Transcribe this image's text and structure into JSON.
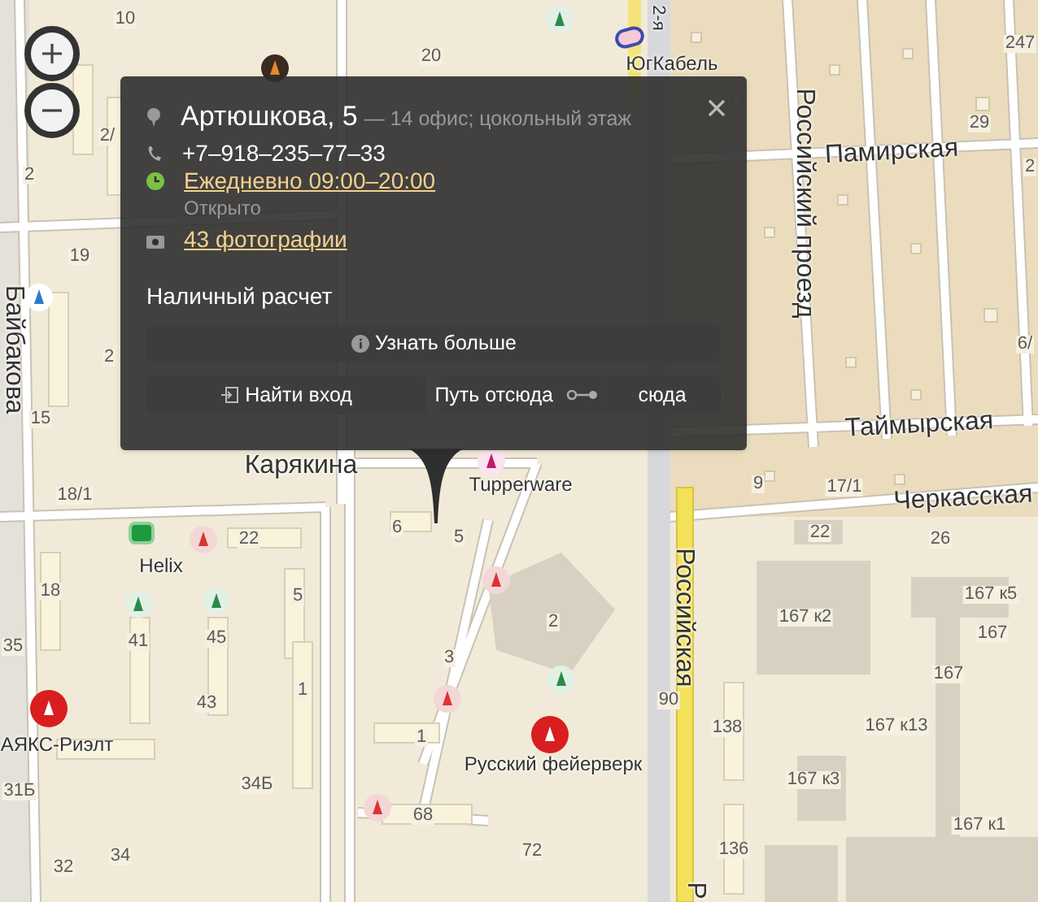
{
  "zoom_controls": [
    {
      "kind": "zoom_in"
    },
    {
      "kind": "zoom_out"
    }
  ],
  "street_labels": [
    "Байбакова",
    "Карякина",
    "Памирская",
    "Российский проезд",
    "Таймырская",
    "Черкасская",
    "Российская",
    "2-я",
    "Р"
  ],
  "place_labels": [
    "ЮгКабель",
    "Tupperware",
    "Helix",
    "АЯКС-Риэлт",
    "Русский фейерверк"
  ],
  "house_numbers": [
    "10",
    "20",
    "2/",
    "2",
    "19",
    "15",
    "18/1",
    "22",
    "18",
    "5",
    "41",
    "45",
    "1",
    "43",
    "35",
    "31Б",
    "34Б",
    "68",
    "32",
    "34",
    "6",
    "5",
    "3",
    "1",
    "2",
    "90",
    "138",
    "136",
    "167 к2",
    "167 к5",
    "167",
    "167",
    "167 к13",
    "167 к3",
    "167 к1",
    "22",
    "26",
    "72",
    "9",
    "17/1",
    "29",
    "247",
    "2",
    "6/",
    "2"
  ],
  "popup": {
    "title": "Артюшкова, 5",
    "subtitle": "— 14 офис; цокольный этаж",
    "phone": "+7–918–235–77–33",
    "hours": "Ежедневно 09:00–20:00",
    "hours_status": "Открыто",
    "photos": "43 фотографии",
    "payment": "Наличный расчет",
    "more_button": "Узнать больше",
    "entrance_button": "Найти вход",
    "route": {
      "from": "Путь отсюда",
      "to": "сюда"
    }
  }
}
